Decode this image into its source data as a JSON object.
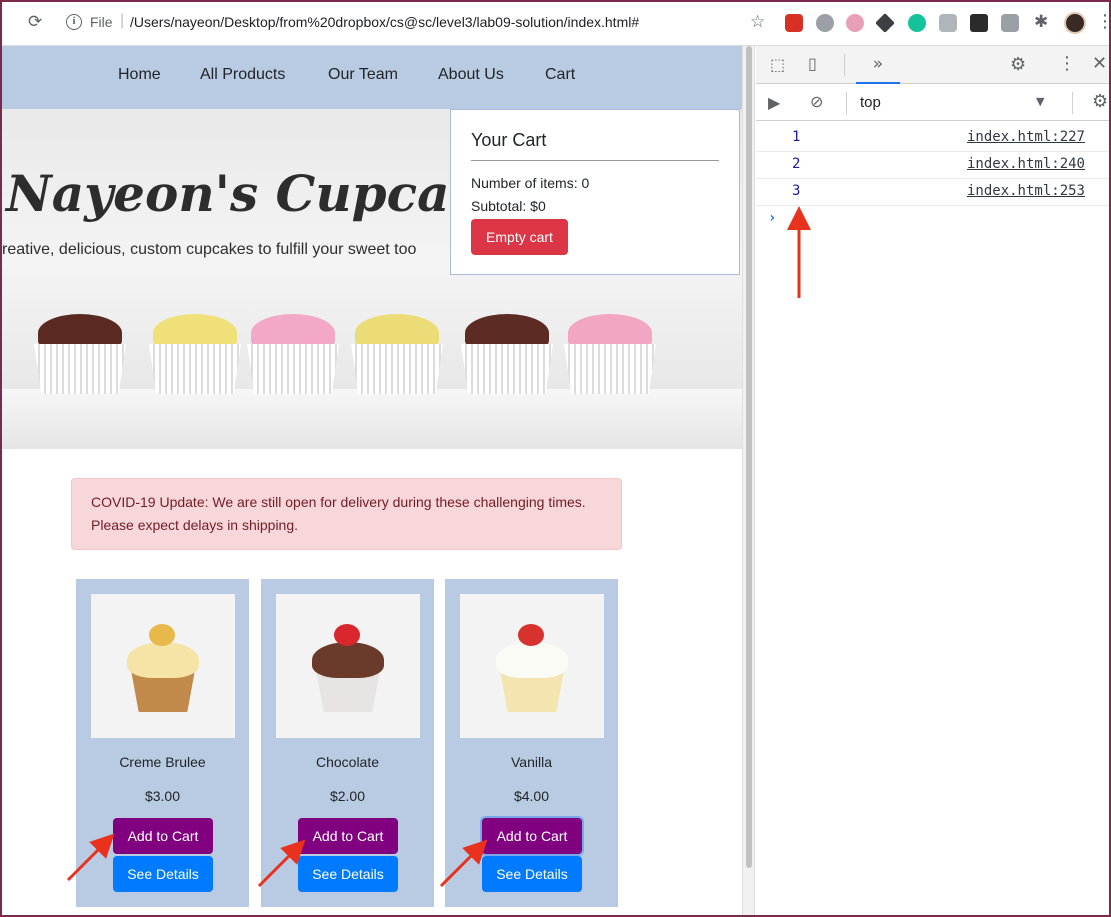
{
  "browser": {
    "reload_icon": "reload-icon",
    "file_label": "File",
    "url": "/Users/nayeon/Desktop/from%20dropbox/cs@sc/level3/lab09-solution/index.html#"
  },
  "nav": {
    "items": [
      "Home",
      "All Products",
      "Our Team",
      "About Us",
      "Cart"
    ]
  },
  "hero": {
    "title": "Nayeon's Cupcakes",
    "subtitle": "reative, delicious, custom cupcakes to fulfill your sweet too"
  },
  "cart": {
    "title": "Your Cart",
    "count_text": "Number of items: 0",
    "subtotal_text": "Subtotal: $0",
    "empty_label": "Empty cart"
  },
  "alert": {
    "text": "COVID-19 Update: We are still open for delivery during these challenging times. Please expect delays in shipping."
  },
  "products": [
    {
      "name": "Creme Brulee",
      "price": "$3.00",
      "add_label": "Add to Cart",
      "details_label": "See Details"
    },
    {
      "name": "Chocolate",
      "price": "$2.00",
      "add_label": "Add to Cart",
      "details_label": "See Details"
    },
    {
      "name": "Vanilla",
      "price": "$4.00",
      "add_label": "Add to Cart",
      "details_label": "See Details"
    }
  ],
  "devtools": {
    "more_tabs": "»",
    "context": "top",
    "logs": [
      {
        "value": "1",
        "source": "index.html:227"
      },
      {
        "value": "2",
        "source": "index.html:240"
      },
      {
        "value": "3",
        "source": "index.html:253"
      }
    ],
    "prompt": "›"
  },
  "colors": {
    "navbar": "#b9cbe3",
    "danger": "#dc3545",
    "purple": "#800080",
    "primary": "#007bff",
    "annotation_arrow": "#e8321e"
  }
}
